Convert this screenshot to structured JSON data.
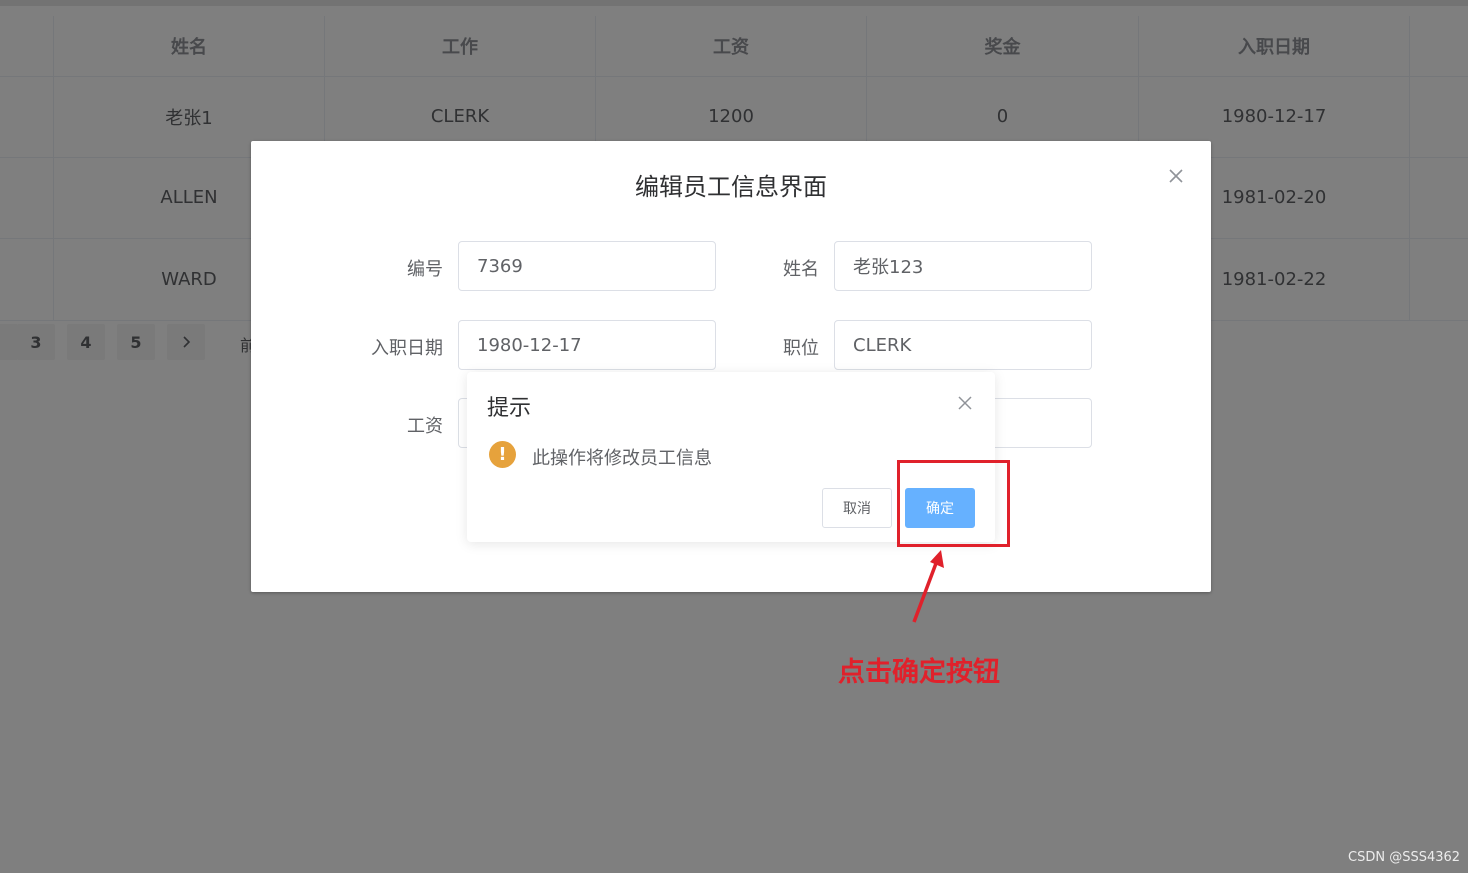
{
  "table": {
    "headers": [
      "",
      "姓名",
      "工作",
      "工资",
      "奖金",
      "入职日期",
      ""
    ],
    "rows": [
      {
        "name": "老张1",
        "job": "CLERK",
        "salary": "1200",
        "bonus": "0",
        "hiredate": "1980-12-17"
      },
      {
        "name": "ALLEN",
        "job": "",
        "salary": "",
        "bonus": "",
        "hiredate": "1981-02-20"
      },
      {
        "name": "WARD",
        "job": "",
        "salary": "",
        "bonus": "",
        "hiredate": "1981-02-22"
      }
    ]
  },
  "pagination": {
    "pages": [
      "3",
      "4",
      "5"
    ],
    "next_icon": "chevron-right-icon",
    "tail_text": "前"
  },
  "edit_dialog": {
    "title": "编辑员工信息界面",
    "close_icon": "close-icon",
    "fields": {
      "empno": {
        "label": "编号",
        "value": "7369"
      },
      "ename": {
        "label": "姓名",
        "value": "老张123"
      },
      "hiredate": {
        "label": "入职日期",
        "value": "1980-12-17"
      },
      "job": {
        "label": "职位",
        "value": "CLERK"
      },
      "salary": {
        "label": "工资",
        "value": ""
      }
    }
  },
  "message_box": {
    "title": "提示",
    "icon": "warning-icon",
    "warn_symbol": "!",
    "message": "此操作将修改员工信息",
    "cancel_label": "取消",
    "confirm_label": "确定",
    "close_icon": "close-icon"
  },
  "annotation": {
    "text": "点击确定按钮",
    "color": "#e0212b"
  },
  "watermark": "CSDN @SSS4362",
  "colors": {
    "primary_light": "#66b1ff",
    "warning": "#e6a23c",
    "annotation_red": "#e0212b"
  }
}
